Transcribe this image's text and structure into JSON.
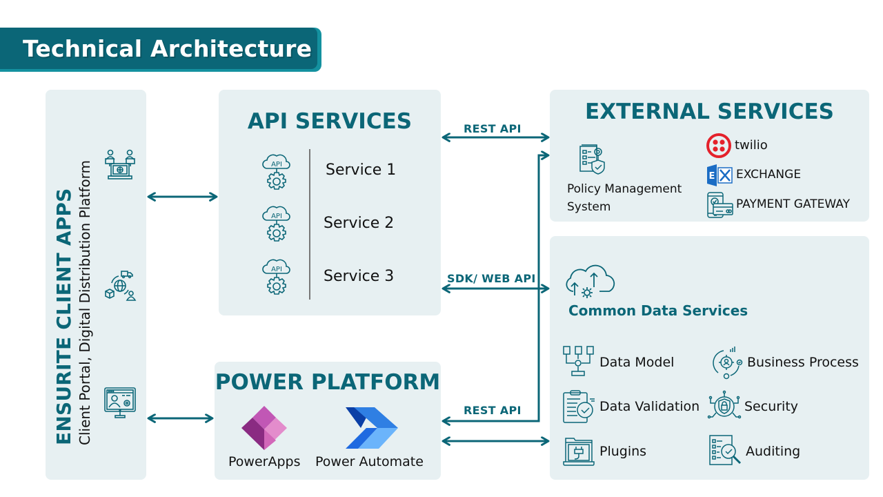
{
  "title": "Technical Architecture",
  "colors": {
    "accent": "#0b6677",
    "banner_shadow": "#14919f",
    "panel_bg": "#e7f0f2",
    "twilio_red": "#e4212b",
    "exchange_blue": "#1a6cc4"
  },
  "client_apps": {
    "title": "ENSURITE CLIENT APPS",
    "subtitle": "Client Portal, Digital Distribution Platform",
    "icons": [
      "video-conference-icon",
      "global-logistics-icon",
      "web-admin-icon"
    ]
  },
  "api_services": {
    "title": "API SERVICES",
    "services": [
      {
        "label": "Service 1",
        "icon": "api-cloud-gear-icon"
      },
      {
        "label": "Service 2",
        "icon": "api-cloud-gear-icon"
      },
      {
        "label": "Service 3",
        "icon": "api-cloud-gear-icon"
      }
    ]
  },
  "power_platform": {
    "title": "POWER PLATFORM",
    "apps": [
      {
        "label": "PowerApps",
        "icon": "powerapps-logo-icon"
      },
      {
        "label": "Power Automate",
        "icon": "power-automate-logo-icon"
      }
    ]
  },
  "external_services": {
    "title": "EXTERNAL SERVICES",
    "policy": {
      "line1": "Policy Management",
      "line2": "System",
      "icon": "policy-document-icon"
    },
    "providers": [
      {
        "label": "twilio",
        "icon": "twilio-logo-icon"
      },
      {
        "label": "EXCHANGE",
        "icon": "exchange-logo-icon"
      },
      {
        "label": "PAYMENT GATEWAY",
        "icon": "payment-gateway-icon"
      }
    ]
  },
  "common_data_services": {
    "title": "Common Data Services",
    "items": [
      {
        "label": "Data Model",
        "icon": "data-model-icon"
      },
      {
        "label": "Business Process",
        "icon": "business-process-icon"
      },
      {
        "label": "Data Validation",
        "icon": "data-validation-icon"
      },
      {
        "label": "Security",
        "icon": "security-lock-icon"
      },
      {
        "label": "Plugins",
        "icon": "plugin-icon"
      },
      {
        "label": "Auditing",
        "icon": "auditing-icon"
      }
    ]
  },
  "connections": {
    "api_external": "REST API",
    "api_cds": "SDK/ WEB API",
    "power_rest": "REST API"
  }
}
